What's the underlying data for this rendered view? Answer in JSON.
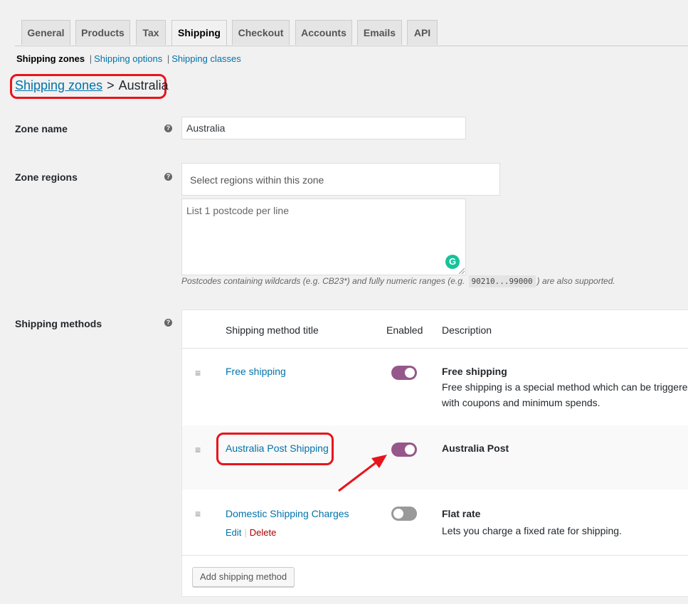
{
  "tabs": [
    {
      "label": "General"
    },
    {
      "label": "Products"
    },
    {
      "label": "Tax"
    },
    {
      "label": "Shipping"
    },
    {
      "label": "Checkout"
    },
    {
      "label": "Accounts"
    },
    {
      "label": "Emails"
    },
    {
      "label": "API"
    }
  ],
  "active_tab": "Shipping",
  "subnav": {
    "zones": "Shipping zones",
    "options": "Shipping options",
    "classes": "Shipping classes",
    "separator": "|"
  },
  "breadcrumb": {
    "link": "Shipping zones",
    "separator": ">",
    "current": "Australia"
  },
  "form": {
    "zone_name_label": "Zone name",
    "zone_name_value": "Australia",
    "zone_regions_label": "Zone regions",
    "regions_placeholder": "Select regions within this zone",
    "postcode_placeholder": "List 1 postcode per line",
    "hint_before": "Postcodes containing wildcards (e.g. CB23*) and fully numeric ranges (e.g. ",
    "hint_code": "90210...99000",
    "hint_after": ") are also supported.",
    "methods_label": "Shipping methods",
    "help_glyph": "?"
  },
  "methods_table": {
    "headers": {
      "title": "Shipping method title",
      "enabled": "Enabled",
      "description": "Description"
    },
    "rows": [
      {
        "title": "Free shipping",
        "enabled": true,
        "desc_title": "Free shipping",
        "desc_text": "Free shipping is a special method which can be triggered with coupons and minimum spends."
      },
      {
        "title": "Australia Post Shipping",
        "enabled": true,
        "desc_title": "Australia Post",
        "desc_text": ""
      },
      {
        "title": "Domestic Shipping Charges",
        "enabled": false,
        "desc_title": "Flat rate",
        "desc_text": "Lets you charge a fixed rate for shipping.",
        "edit": "Edit",
        "delete": "Delete",
        "action_sep": "|"
      }
    ],
    "add_button": "Add shipping method"
  },
  "icons": {
    "handle": "drag-handle-icon",
    "help": "help-icon",
    "grammarly": "grammarly-icon",
    "annotation": "red-arrow-icon"
  },
  "colors": {
    "link": "#0073aa",
    "toggle_on": "#96588a",
    "toggle_off": "#999999",
    "annotation": "#e8141c",
    "delete": "#aa0000"
  }
}
